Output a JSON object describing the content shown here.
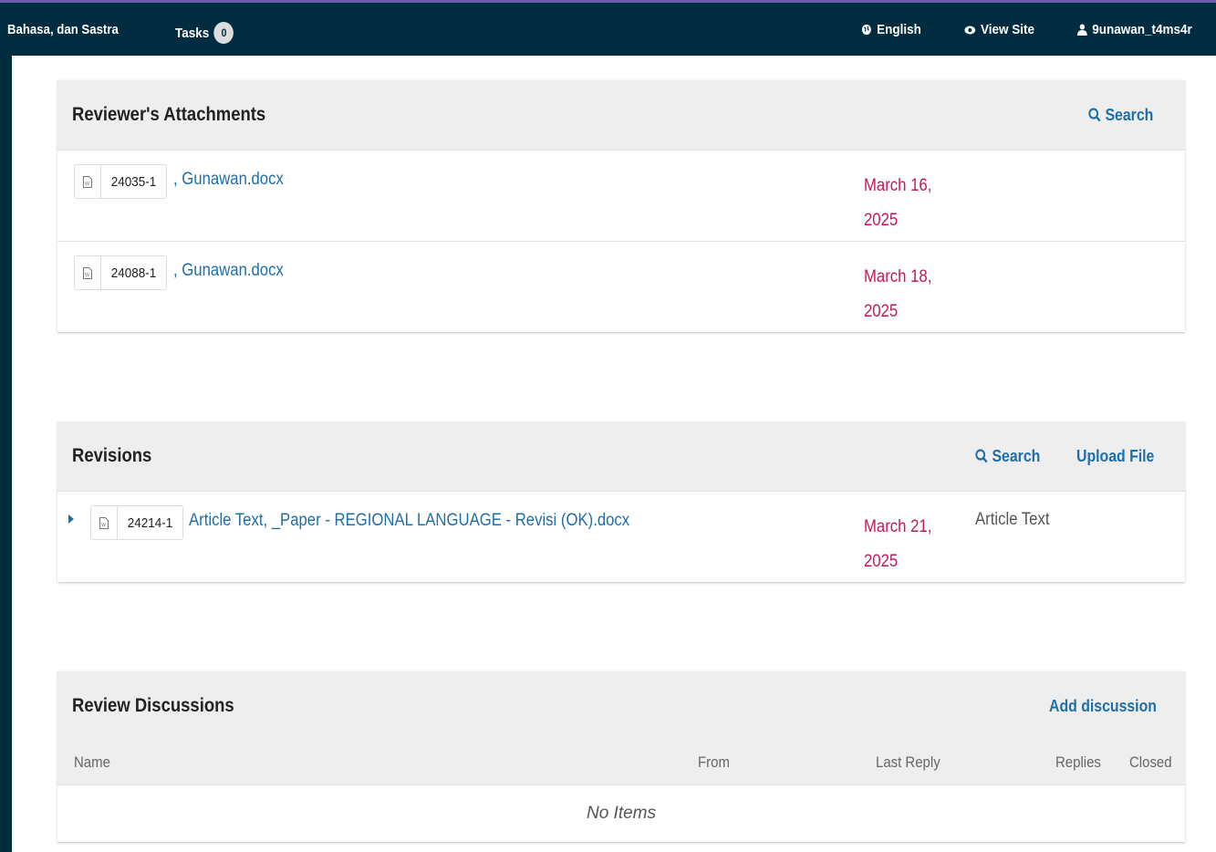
{
  "topbar": {
    "site_name": "Bahasa, dan Sastra",
    "tasks_label": "Tasks",
    "tasks_count": "0",
    "language": "English",
    "view_site": "View Site",
    "username": "9unawan_t4ms4r"
  },
  "attachments": {
    "title": "Reviewer's Attachments",
    "search_label": "Search",
    "files": [
      {
        "id": "24035-1",
        "name": ", Gunawan.docx",
        "date_line1": "March 16,",
        "date_line2": "2025"
      },
      {
        "id": "24088-1",
        "name": ", Gunawan.docx",
        "date_line1": "March 18,",
        "date_line2": "2025"
      }
    ]
  },
  "revisions": {
    "title": "Revisions",
    "search_label": "Search",
    "upload_label": "Upload File",
    "files": [
      {
        "id": "24214-1",
        "name": "Article Text, _Paper - REGIONAL LANGUAGE - Revisi (OK).docx",
        "date_line1": "March 21,",
        "date_line2": "2025",
        "type": "Article Text"
      }
    ]
  },
  "discussions": {
    "title": "Review Discussions",
    "add_label": "Add discussion",
    "columns": {
      "name": "Name",
      "from": "From",
      "last_reply": "Last Reply",
      "replies": "Replies",
      "closed": "Closed"
    },
    "empty": "No Items"
  }
}
